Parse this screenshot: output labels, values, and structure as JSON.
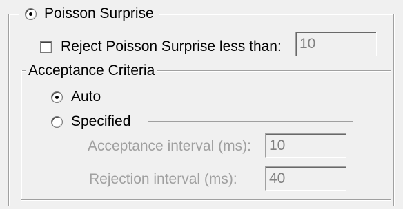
{
  "poisson": {
    "label": "Poisson Surprise",
    "selected": true,
    "reject": {
      "label": "Reject Poisson Surprise less than:",
      "checked": false,
      "value": "10"
    }
  },
  "acceptance": {
    "group_label": "Acceptance Criteria",
    "auto": {
      "label": "Auto",
      "selected": true
    },
    "specified": {
      "label": "Specified",
      "selected": false
    },
    "acceptance_interval": {
      "label": "Acceptance interval (ms):",
      "value": "10"
    },
    "rejection_interval": {
      "label": "Rejection interval (ms):",
      "value": "40"
    }
  }
}
